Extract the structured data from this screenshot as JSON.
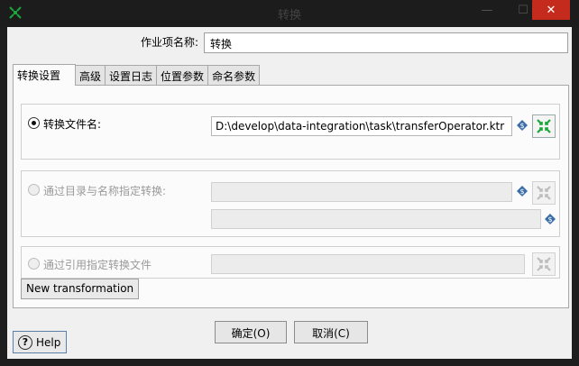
{
  "window": {
    "title": "转换",
    "minimize_glyph": "—",
    "maximize_glyph": "☐",
    "close_glyph": "✕"
  },
  "job_entry": {
    "name_label": "作业项名称:",
    "name_value": "转换"
  },
  "tabs": [
    {
      "label": "转换设置",
      "active": true
    },
    {
      "label": "高级",
      "active": false
    },
    {
      "label": "设置日志",
      "active": false
    },
    {
      "label": "位置参数",
      "active": false
    },
    {
      "label": "命名参数",
      "active": false
    }
  ],
  "options": {
    "by_filename": {
      "label": "转换文件名:",
      "selected": true,
      "value": "D:\\develop\\data-integration\\task\\transferOperator.ktr"
    },
    "by_directory": {
      "label": "通过目录与名称指定转换:",
      "selected": false,
      "directory_value": "",
      "name_value": ""
    },
    "by_reference": {
      "label": "通过引用指定转换文件",
      "selected": false,
      "value": ""
    }
  },
  "buttons": {
    "new_transformation": "New transformation",
    "ok": "确定(O)",
    "cancel": "取消(C)",
    "help": "Help"
  },
  "icons": {
    "app": "kettle-spoon-icon",
    "variable": "variable-dollar-icon",
    "browse": "browse-repository-icon",
    "help": "help-question-icon"
  },
  "colors": {
    "close_button": "#c42b1c",
    "browse_green": "#1aa63a",
    "variable_blue": "#3b6ea8"
  }
}
